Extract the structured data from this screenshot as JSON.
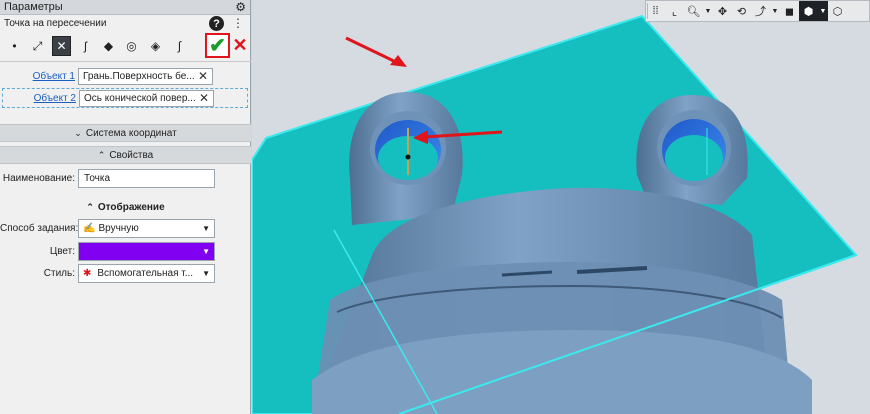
{
  "panel": {
    "title": "Параметры",
    "command_title": "Точка на пересечении",
    "tools": [
      {
        "icon": "point-icon",
        "glyph": "•"
      },
      {
        "icon": "point-on-curve-icon",
        "glyph": "⤢"
      },
      {
        "icon": "intersection-point-icon",
        "glyph": "✕"
      },
      {
        "icon": "curve-point-icon",
        "glyph": "ʃ"
      },
      {
        "icon": "surface-point-icon",
        "glyph": "◆"
      },
      {
        "icon": "center-point-icon",
        "glyph": "◎"
      },
      {
        "icon": "projection-point-icon",
        "glyph": "◈"
      },
      {
        "icon": "offset-point-icon",
        "glyph": "∫"
      }
    ],
    "ok_glyph": "✔",
    "cancel_glyph": "✕",
    "object1": {
      "label": "Объект 1",
      "value": "Грань.Поверхность бе..."
    },
    "object2": {
      "label": "Объект 2",
      "value": "Ось конической повер..."
    },
    "sections": {
      "coords": "Система координат",
      "props": "Свойства"
    },
    "name_label": "Наименование:",
    "name_value": "Точка",
    "display_heading": "Отображение",
    "method_label": "Способ задания:",
    "method_value": "Вручную",
    "color_label": "Цвет:",
    "color_value": "#8200f2",
    "style_label": "Стиль:",
    "style_value": "Вспомогательная т..."
  },
  "colors": {
    "plane": "#16bfbf",
    "part": "#6f93b8",
    "hole_inner": "#2a6de0",
    "arrow": "#e0141b"
  }
}
